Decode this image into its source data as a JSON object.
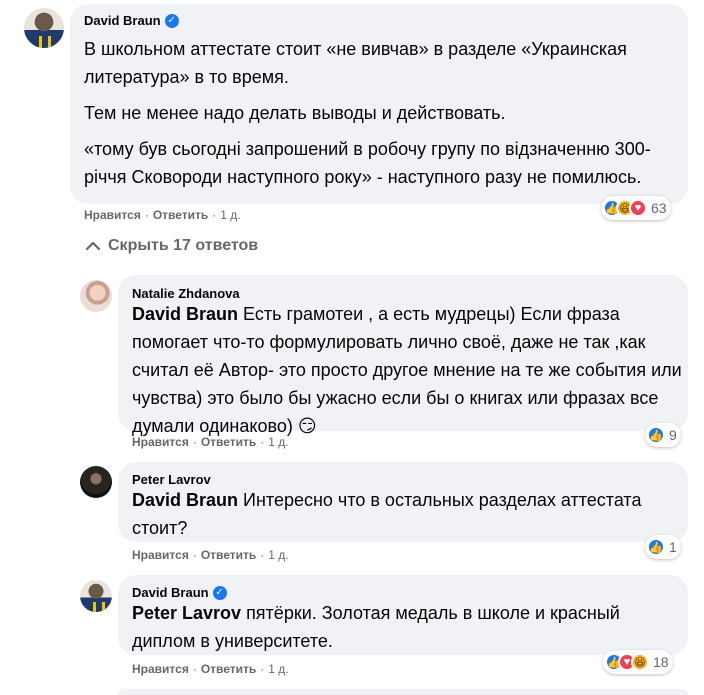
{
  "comments": [
    {
      "author": "David Braun",
      "verified": true,
      "paragraphs": [
        "В школьном аттестате стоит «не вивчав» в разделе «Украинская литература» в то время.",
        "Тем не менее надо делать выводы и действовать.",
        "«тому був сьогодні запрошений в робочу групу по відзначенню 300-річчя Сковороди наступного року» - наступного разу не помилюсь."
      ],
      "like_label": "Нравится",
      "reply_label": "Ответить",
      "time": "1 д.",
      "reactions": [
        "like-icon",
        "haha-icon",
        "love-icon"
      ],
      "reaction_count": "63"
    }
  ],
  "hide_replies_label": "Скрыть 17 ответов",
  "replies": [
    {
      "author": "Natalie Zhdanova",
      "mention": "David Braun",
      "text": " Есть грамотеи , а есть мудрецы) Если фраза помогает что-то формулировать лично своё, даже не так ,как считал её Автор- это просто другое мнение на те же события или чувства) это было бы ужасно если бы о книгах или фразах все думали одинаково)",
      "emoji": "😏",
      "like_label": "Нравится",
      "reply_label": "Ответить",
      "time": "1 д.",
      "reactions": [
        "like-icon"
      ],
      "reaction_count": "9"
    },
    {
      "author": "Peter Lavrov",
      "mention": "David Braun",
      "text": " Интересно что в остальных разделах аттестата стоит?",
      "like_label": "Нравится",
      "reply_label": "Ответить",
      "time": "1 д.",
      "reactions": [
        "like-icon"
      ],
      "reaction_count": "1"
    },
    {
      "author": "David Braun",
      "verified": true,
      "mention": "Peter Lavrov",
      "text": " пятёрки. Золотая медаль в школе и красный диплом в университете.",
      "like_label": "Нравится",
      "reply_label": "Ответить",
      "time": "1 д.",
      "reactions": [
        "like-icon",
        "love-icon",
        "haha-icon"
      ],
      "reaction_count": "18"
    }
  ],
  "separator": "·",
  "colors": {
    "bubble": "#f0f2f5",
    "meta_text": "#65676b",
    "like_blue": "#1877f2",
    "love_red": "#f33e58",
    "haha_yellow": "#f7b125"
  }
}
